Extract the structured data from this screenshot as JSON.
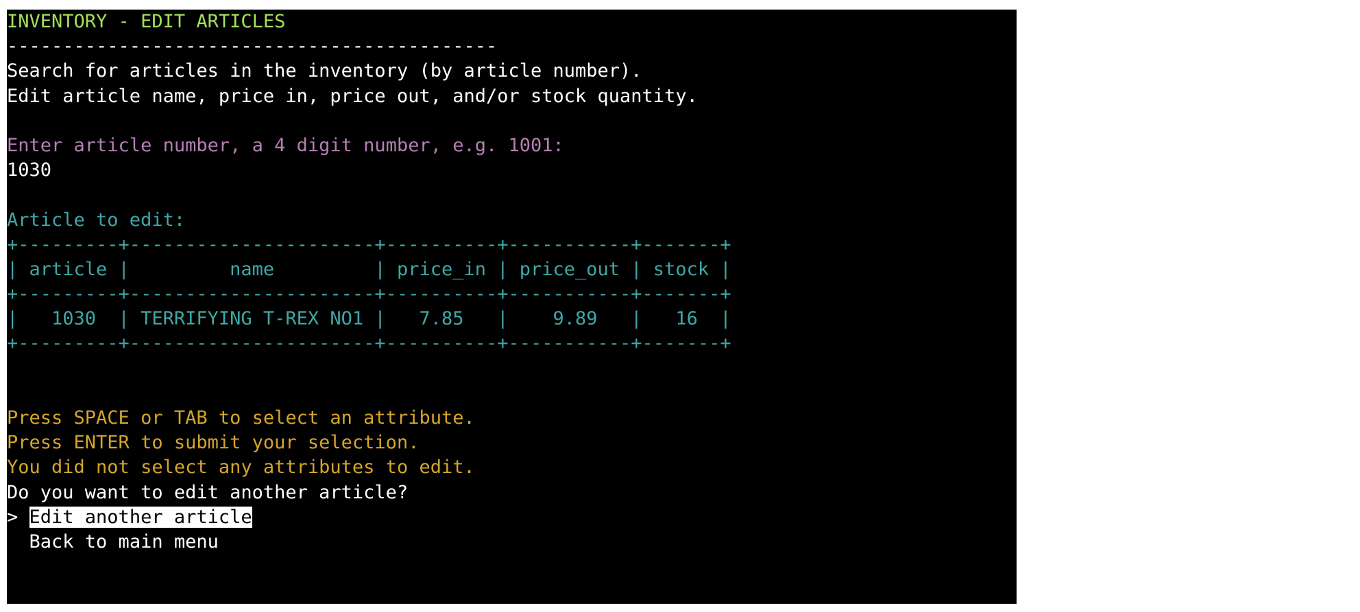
{
  "terminal": {
    "title": "INVENTORY - EDIT ARTICLES",
    "divider": "--------------------------------------------",
    "intro_lines": [
      "Search for articles in the inventory (by article number).",
      "Edit article name, price in, price out, and/or stock quantity."
    ],
    "prompt": {
      "label": "Enter article number, a 4 digit number, e.g. 1001:",
      "value": "1030"
    },
    "article_heading": "Article to edit:",
    "table": {
      "border": "+---------+----------------------+----------+-----------+-------+",
      "header_row": "| article |         name         | price_in | price_out | stock |",
      "data_row": "|   1030  | TERRIFYING T-REX NO1 |   7.85   |    9.89   |   16  |",
      "columns": [
        "article",
        "name",
        "price_in",
        "price_out",
        "stock"
      ],
      "rows": [
        {
          "article": "1030",
          "name": "TERRIFYING T-REX NO1",
          "price_in": "7.85",
          "price_out": "9.89",
          "stock": "16"
        }
      ]
    },
    "instructions": [
      "Press SPACE or TAB to select an attribute.",
      "Press ENTER to submit your selection.",
      "You did not select any attributes to edit."
    ],
    "question": "Do you want to edit another article?",
    "menu": {
      "cursor": "> ",
      "indent": "  ",
      "options": [
        "Edit another article",
        "Back to main menu"
      ],
      "selected_index": 0
    },
    "colors": {
      "background": "#000000",
      "title": "#a3e05a",
      "prompt": "#b57fb5",
      "table": "#3fa7a7",
      "instructions": "#d4a52a",
      "text": "#ffffff"
    }
  }
}
